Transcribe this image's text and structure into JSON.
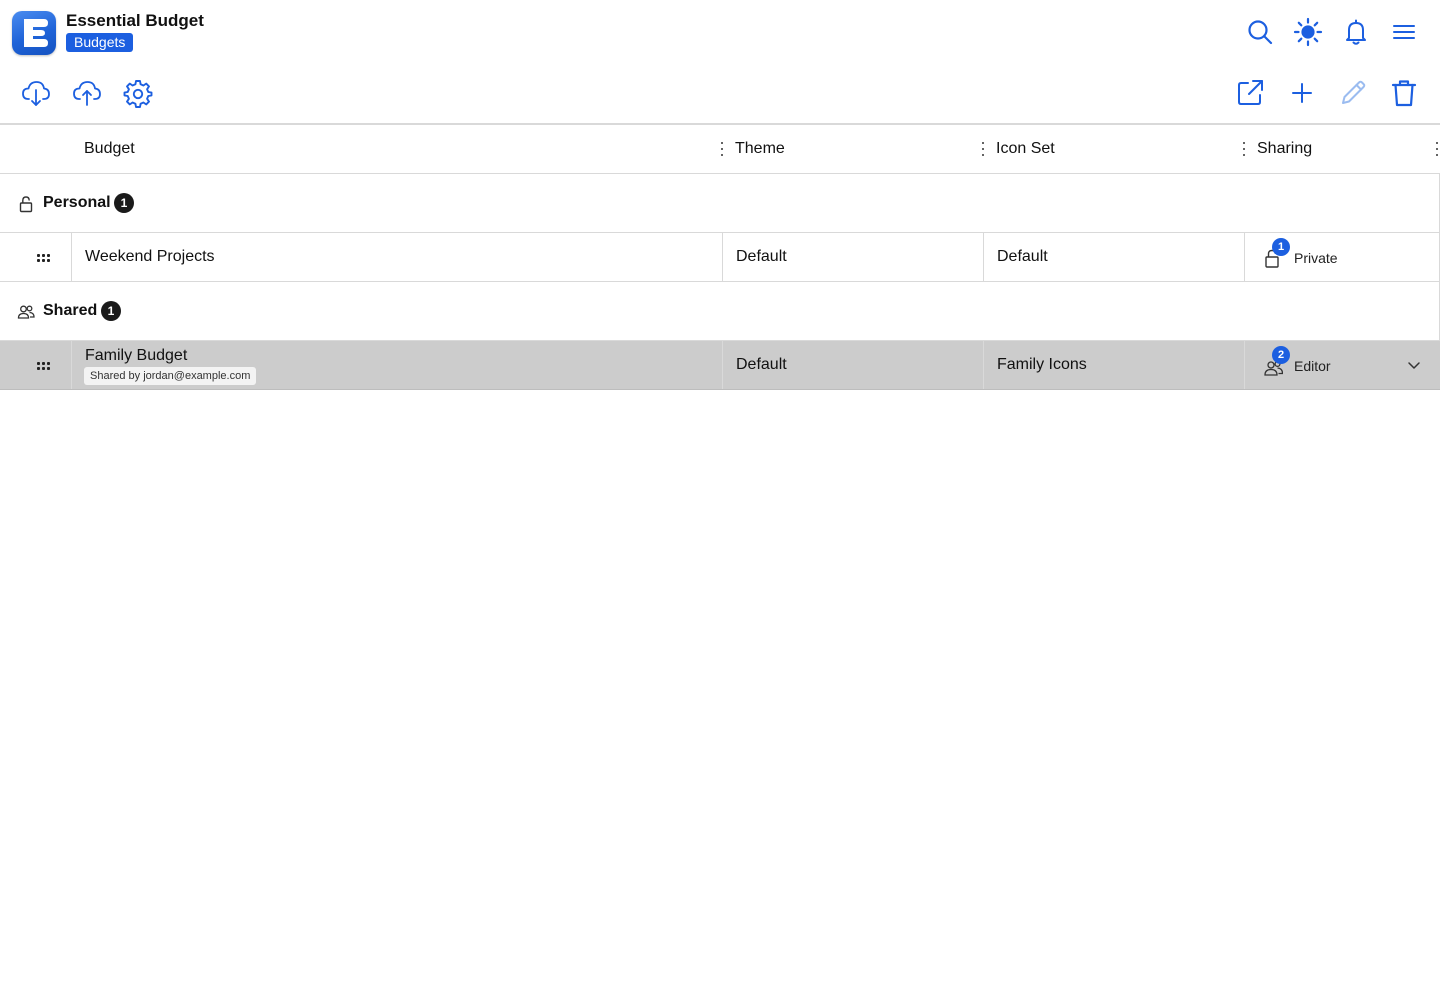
{
  "app": {
    "title": "Essential Budget",
    "page": "Budgets",
    "logo_letter": "E"
  },
  "header_icons": [
    "search-icon",
    "theme-sun-icon",
    "notifications-bell-icon",
    "menu-icon"
  ],
  "toolbar": {
    "left": [
      "cloud-download-icon",
      "cloud-upload-icon",
      "settings-gear-icon"
    ],
    "right": [
      "open-external-icon",
      "add-plus-icon",
      "edit-pencil-icon",
      "delete-trash-icon"
    ]
  },
  "colors": {
    "accent": "#1c5fe0",
    "selected_row": "#cccccc",
    "badge_dark": "#1a1a1a",
    "disabled_icon": "#9bbcf0"
  },
  "table": {
    "columns": [
      "Budget",
      "Theme",
      "Icon Set",
      "Sharing"
    ],
    "groups": [
      {
        "label": "Personal",
        "count": "1",
        "icon": "lock-icon",
        "rows": [
          {
            "budget": "Weekend Projects",
            "subtitle": "",
            "theme": "Default",
            "icon_set": "Default",
            "sharing_count": "1",
            "sharing_label": "Private",
            "sharing_icon": "lock-icon",
            "selected": false
          }
        ]
      },
      {
        "label": "Shared",
        "count": "1",
        "icon": "users-icon",
        "rows": [
          {
            "budget": "Family Budget",
            "subtitle": "Shared by jordan@example.com",
            "theme": "Default",
            "icon_set": "Family Icons",
            "sharing_count": "2",
            "sharing_label": "Editor",
            "sharing_icon": "users-icon",
            "selected": true
          }
        ]
      }
    ]
  }
}
